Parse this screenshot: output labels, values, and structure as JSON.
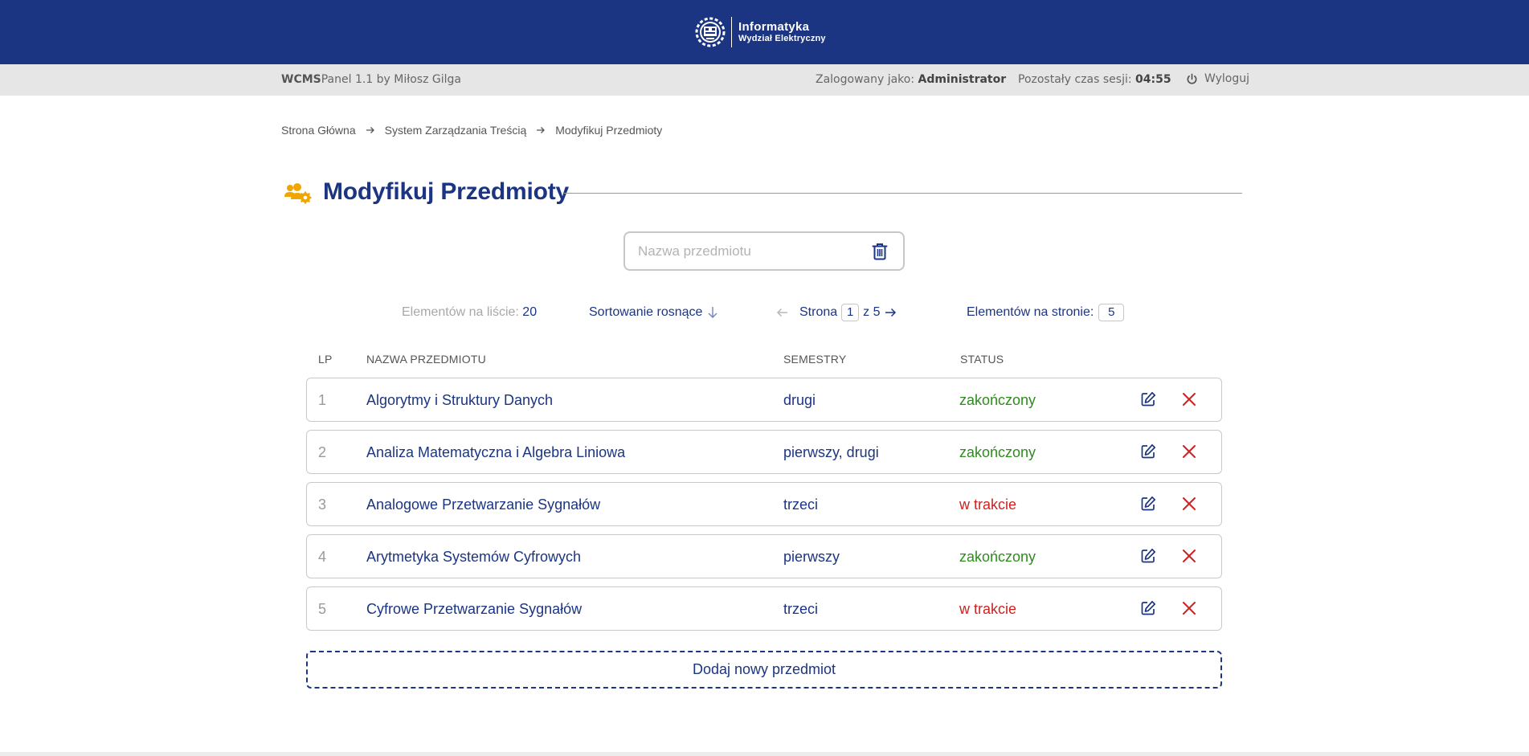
{
  "brand": {
    "title": "Informatyka",
    "subtitle": "Wydział Elektryczny",
    "logo_icon": "university-gear-logo"
  },
  "session": {
    "app_name": "WCMS",
    "app_rest": "Panel 1.1 by Miłosz Gilga",
    "logged_label": "Zalogowany jako: ",
    "logged_user": "Administrator",
    "time_label": "Pozostały czas sesji: ",
    "time_value": "04:55",
    "logout_label": "Wyloguj"
  },
  "breadcrumb": [
    "Strona Główna",
    "System Zarządzania Treścią",
    "Modyfikuj Przedmioty"
  ],
  "page": {
    "title": "Modyfikuj Przedmioty",
    "title_icon": "users-gear-icon",
    "accent_color": "#f0a500",
    "primary_color": "#1b3583"
  },
  "search": {
    "placeholder": "Nazwa przedmiotu",
    "value": ""
  },
  "toolbar": {
    "count_label": "Elementów na liście: ",
    "count_value": "20",
    "sort_label": "Sortowanie rosnące",
    "page_label": "Strona",
    "page_current": "1",
    "page_of": "z 5",
    "per_page_label": "Elementów na stronie:",
    "per_page_value": "5"
  },
  "table": {
    "headers": [
      "LP",
      "NAZWA PRZEDMIOTU",
      "SEMESTRY",
      "STATUS"
    ],
    "rows": [
      {
        "lp": "1",
        "name": "Algorytmy i Struktury Danych",
        "semesters": "drugi",
        "status": "zakończony",
        "status_kind": "done"
      },
      {
        "lp": "2",
        "name": "Analiza Matematyczna i Algebra Liniowa",
        "semesters": "pierwszy, drugi",
        "status": "zakończony",
        "status_kind": "done"
      },
      {
        "lp": "3",
        "name": "Analogowe Przetwarzanie Sygnałów",
        "semesters": "trzeci",
        "status": "w trakcie",
        "status_kind": "progress"
      },
      {
        "lp": "4",
        "name": "Arytmetyka Systemów Cyfrowych",
        "semesters": "pierwszy",
        "status": "zakończony",
        "status_kind": "done"
      },
      {
        "lp": "5",
        "name": "Cyfrowe Przetwarzanie Sygnałów",
        "semesters": "trzeci",
        "status": "w trakcie",
        "status_kind": "progress"
      }
    ]
  },
  "add_button": "Dodaj nowy przedmiot",
  "colors": {
    "done": "#2e8b1e",
    "progress": "#cc2222",
    "delete": "#cc2222"
  }
}
